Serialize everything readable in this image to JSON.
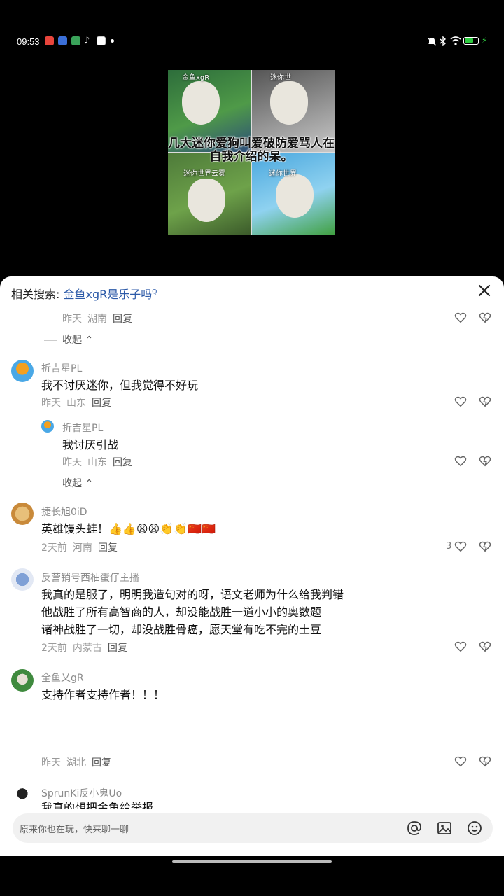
{
  "status": {
    "time": "09:53",
    "notification_icons": [
      "app-red-icon",
      "app-blue-icon",
      "app-green-icon",
      "tiktok-icon",
      "app-doc-icon"
    ],
    "system_icons": [
      "mute-icon",
      "bluetooth-icon",
      "wifi-icon",
      "battery-icon",
      "charging-icon"
    ]
  },
  "video": {
    "caption": "几大迷你爱狗叫爱破防爱骂人在自我介绍的呆。",
    "labels": [
      "金鱼xgR",
      "迷你世",
      "迷你世界云雾",
      "迷你世界"
    ]
  },
  "related_search": {
    "prefix": "相关搜索:",
    "query": "金鱼xgR是乐子吗",
    "search_mark": "Q"
  },
  "comments": [
    {
      "type": "meta",
      "time": "昨天",
      "location": "湖南",
      "reply": "回复"
    },
    {
      "type": "collapse",
      "label": "收起"
    },
    {
      "user": "折吉星PL",
      "text": "我不讨厌迷你，但我觉得不好玩",
      "time": "昨天",
      "location": "山东",
      "reply": "回复"
    },
    {
      "user": "折吉星PL",
      "text": "我讨厌引战",
      "time": "昨天",
      "location": "山东",
      "reply": "回复"
    },
    {
      "type": "collapse",
      "label": "收起"
    },
    {
      "user": "捷长旭0iD",
      "text": "英雄馒头蛙！👍👍😩😩👏👏🇨🇳🇨🇳",
      "time": "2天前",
      "location": "河南",
      "reply": "回复",
      "likes": "3"
    },
    {
      "user": "反营销号西柚蛋仔主播",
      "text": "我真的是服了，明明我造句对的呀，语文老师为什么给我判错\n他战胜了所有高智商的人，却没能战胜一道小小的奥数题\n诸神战胜了一切，却没战胜骨癌，愿天堂有吃不完的土豆",
      "time": "2天前",
      "location": "内蒙古",
      "reply": "回复"
    },
    {
      "user": "全鱼乂gR",
      "text": "支持作者支持作者！！！",
      "time": "昨天",
      "location": "湖北",
      "reply": "回复"
    },
    {
      "user": "SprunKi反小鬼Uo",
      "text": "我真的想把金鱼给举报"
    }
  ],
  "input": {
    "placeholder": "原来你也在玩，快来聊一聊",
    "buttons": [
      "at-icon",
      "image-icon",
      "emoji-icon"
    ]
  },
  "colors": {
    "link": "#2c5aa8",
    "muted": "#9a9a9a",
    "sheet_bg": "#ffffff",
    "input_bg": "#f1f1f1"
  }
}
